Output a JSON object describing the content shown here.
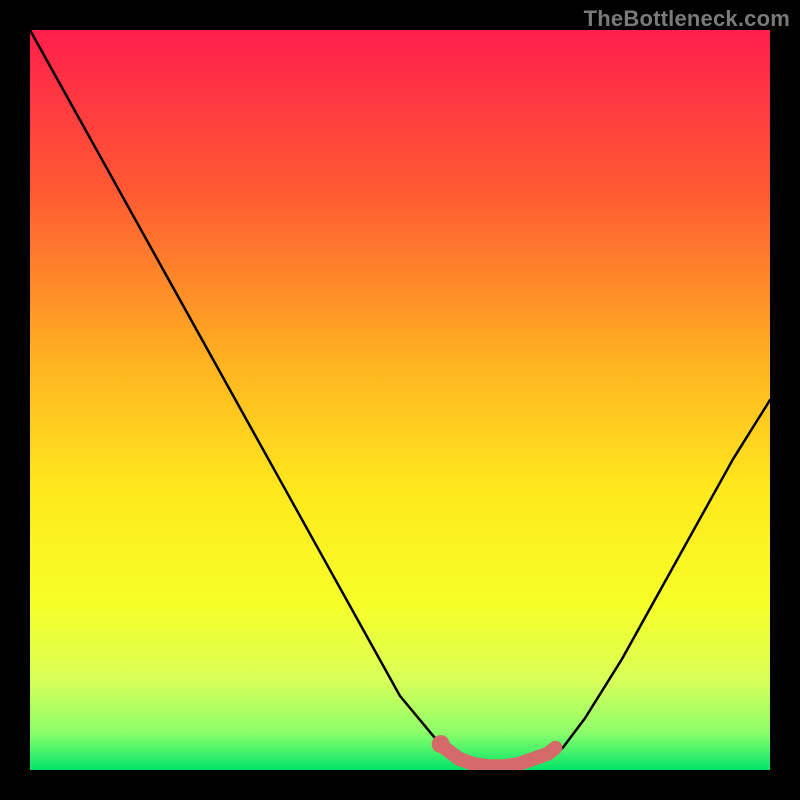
{
  "watermark": "TheBottleneck.com",
  "colors": {
    "gradient_top": "#ff1f4b",
    "gradient_mid_upper": "#ff6a2a",
    "gradient_mid": "#ffd21e",
    "gradient_mid_lower": "#f6ff2a",
    "gradient_low": "#d8ff5a",
    "gradient_bottom": "#00e46a",
    "curve": "#000000",
    "highlight": "#d46a6a",
    "bg": "#000000"
  },
  "chart_data": {
    "type": "line",
    "title": "",
    "xlabel": "",
    "ylabel": "",
    "xlim": [
      0,
      100
    ],
    "ylim": [
      0,
      100
    ],
    "series": [
      {
        "name": "bottleneck-curve",
        "x": [
          0,
          5,
          10,
          15,
          20,
          25,
          30,
          35,
          40,
          45,
          50,
          55,
          58,
          60,
          62,
          65,
          68,
          70,
          72,
          75,
          80,
          85,
          90,
          95,
          100
        ],
        "y": [
          100,
          91,
          82,
          73,
          64,
          55,
          46,
          37,
          28,
          19,
          10,
          4,
          1.5,
          0.8,
          0.5,
          0.5,
          0.8,
          1.5,
          3,
          7,
          15,
          24,
          33,
          42,
          50
        ]
      }
    ],
    "highlight_segment": {
      "name": "bottom-arc",
      "x": [
        56,
        58,
        60,
        62,
        64,
        66,
        68,
        70,
        71
      ],
      "y": [
        3,
        1.5,
        0.8,
        0.5,
        0.5,
        0.8,
        1.5,
        2.2,
        3
      ]
    },
    "highlight_dot": {
      "x": 55.5,
      "y": 3.5
    },
    "annotations": []
  }
}
